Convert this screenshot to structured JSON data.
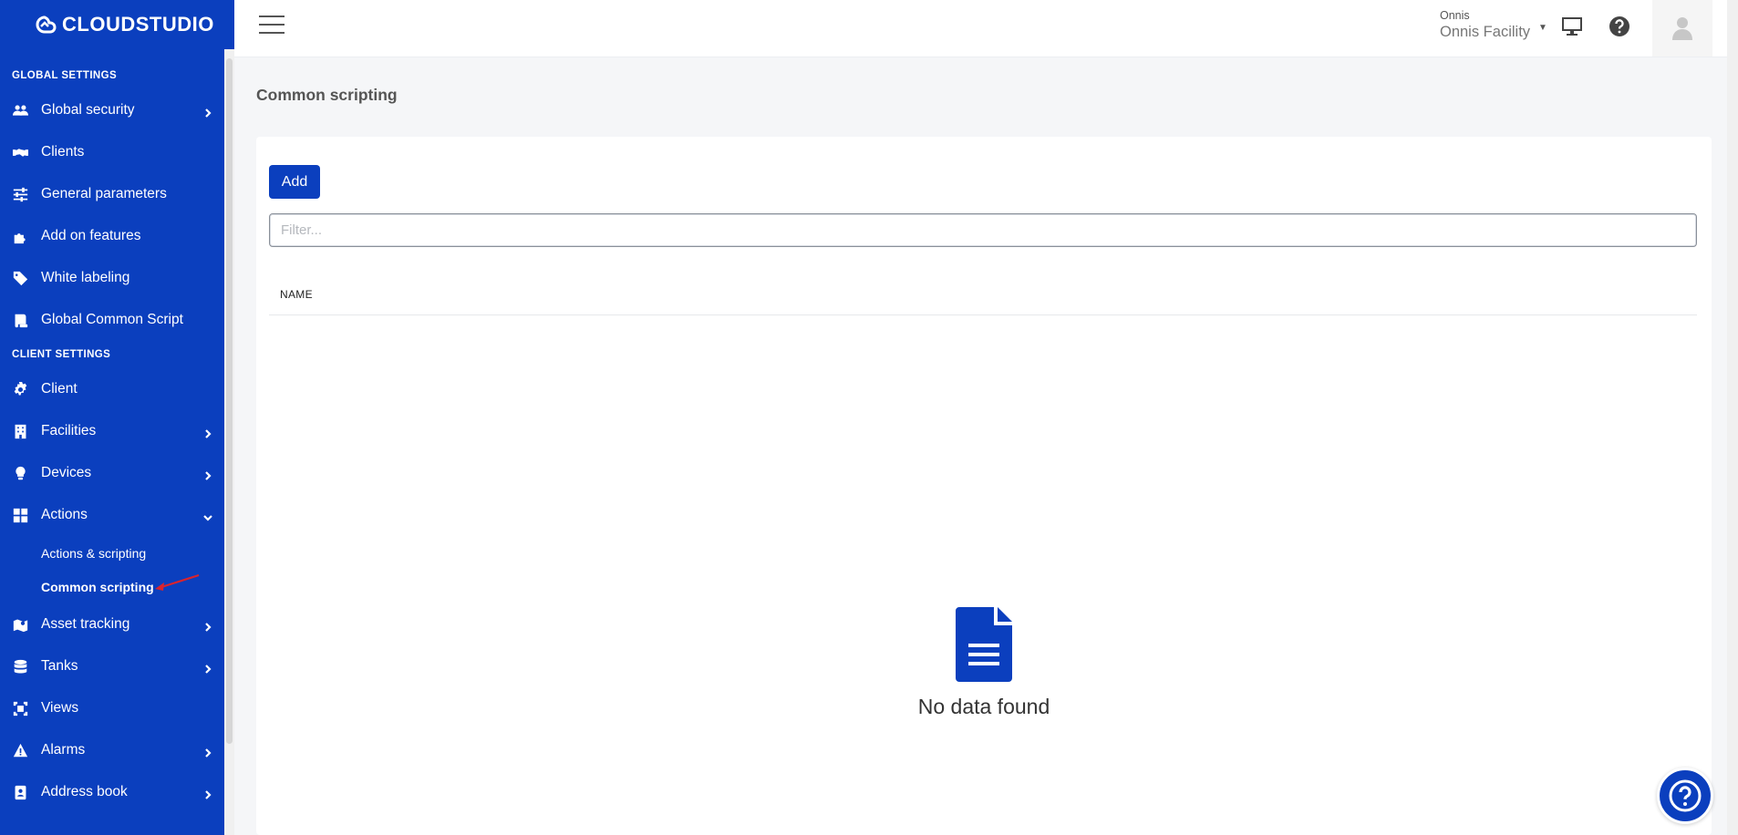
{
  "brand": {
    "name": "CLOUDSTUDIO"
  },
  "sidebar": {
    "global_title": "GLOBAL SETTINGS",
    "global_items": [
      {
        "label": "Global security",
        "icon": "users-icon",
        "has_children": true
      },
      {
        "label": "Clients",
        "icon": "handshake-icon",
        "has_children": false
      },
      {
        "label": "General parameters",
        "icon": "sliders-icon",
        "has_children": false
      },
      {
        "label": "Add on features",
        "icon": "puzzle-icon",
        "has_children": false
      },
      {
        "label": "White labeling",
        "icon": "tag-icon",
        "has_children": false
      },
      {
        "label": "Global Common Script",
        "icon": "scroll-icon",
        "has_children": false
      }
    ],
    "client_title": "CLIENT SETTINGS",
    "client_items": [
      {
        "label": "Client",
        "icon": "gear-icon"
      },
      {
        "label": "Facilities",
        "icon": "building-icon"
      },
      {
        "label": "Devices",
        "icon": "lightbulb-icon"
      },
      {
        "label": "Actions",
        "icon": "grid-icon"
      },
      {
        "label": "Asset tracking",
        "icon": "map-icon"
      },
      {
        "label": "Tanks",
        "icon": "database-icon"
      },
      {
        "label": "Views",
        "icon": "frame-icon"
      },
      {
        "label": "Alarms",
        "icon": "warning-icon"
      },
      {
        "label": "Address book",
        "icon": "address-book-icon"
      }
    ],
    "actions_sub": [
      {
        "label": "Actions & scripting",
        "active": false
      },
      {
        "label": "Common scripting",
        "active": true
      }
    ]
  },
  "topbar": {
    "org_client": "Onnis",
    "org_facility": "Onnis Facility"
  },
  "main": {
    "title": "Common scripting",
    "add_label": "Add",
    "filter_placeholder": "Filter...",
    "column_name": "NAME",
    "empty_text": "No data found"
  },
  "colors": {
    "accent": "#0b3fbe",
    "background": "#f5f6f8"
  }
}
